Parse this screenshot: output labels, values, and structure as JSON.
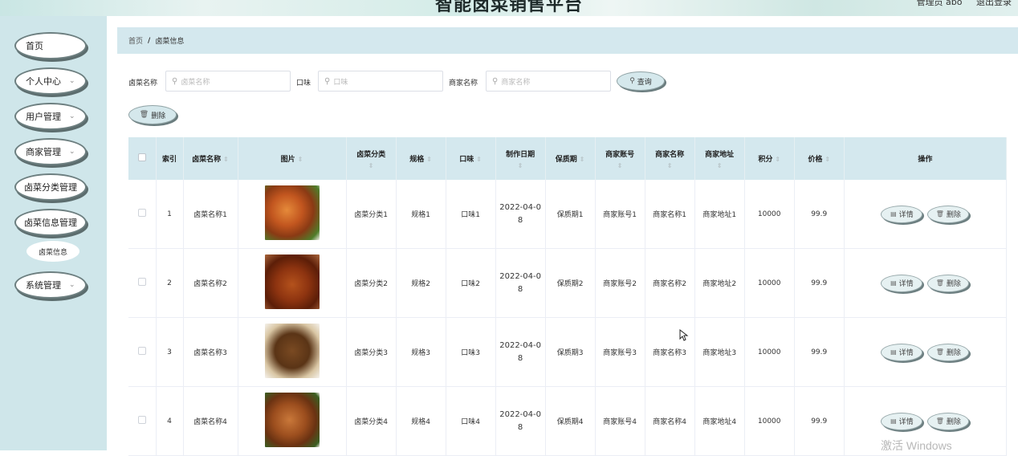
{
  "header": {
    "title": "智能卤菜销售平台",
    "user_label": "管理员 abo",
    "logout_label": "退出登录"
  },
  "sidebar": {
    "items": [
      {
        "label": "首页",
        "expandable": false
      },
      {
        "label": "个人中心",
        "expandable": true
      },
      {
        "label": "用户管理",
        "expandable": true
      },
      {
        "label": "商家管理",
        "expandable": true
      },
      {
        "label": "卤菜分类管理",
        "expandable": false
      },
      {
        "label": "卤菜信息管理",
        "expandable": false
      },
      {
        "label": "系统管理",
        "expandable": true
      }
    ],
    "submenu_label": "卤菜信息"
  },
  "breadcrumb": {
    "home": "首页",
    "separator": "/",
    "current": "卤菜信息"
  },
  "search": {
    "name_label": "卤菜名称",
    "name_placeholder": "卤菜名称",
    "flavor_label": "口味",
    "flavor_placeholder": "口味",
    "merchant_label": "商家名称",
    "merchant_placeholder": "商家名称",
    "query_button": "查询",
    "delete_button": "删除"
  },
  "table": {
    "headers": {
      "index": "索引",
      "name": "卤菜名称",
      "image": "图片",
      "category": "卤菜分类",
      "spec": "规格",
      "flavor": "口味",
      "made_date": "制作日期",
      "shelf_life": "保质期",
      "merchant_account": "商家账号",
      "merchant_name": "商家名称",
      "merchant_address": "商家地址",
      "points": "积分",
      "price": "价格",
      "actions": "操作"
    },
    "detail_button": "详情",
    "delete_button": "删除",
    "rows": [
      {
        "index": "1",
        "name": "卤菜名称1",
        "category": "卤菜分类1",
        "spec": "规格1",
        "flavor": "口味1",
        "date_a": "2022-04-0",
        "date_b": "8",
        "shelf_life": "保质期1",
        "merchant_account": "商家账号1",
        "merchant_name": "商家名称1",
        "merchant_address": "商家地址1",
        "points": "10000",
        "price": "99.9"
      },
      {
        "index": "2",
        "name": "卤菜名称2",
        "category": "卤菜分类2",
        "spec": "规格2",
        "flavor": "口味2",
        "date_a": "2022-04-0",
        "date_b": "8",
        "shelf_life": "保质期2",
        "merchant_account": "商家账号2",
        "merchant_name": "商家名称2",
        "merchant_address": "商家地址2",
        "points": "10000",
        "price": "99.9"
      },
      {
        "index": "3",
        "name": "卤菜名称3",
        "category": "卤菜分类3",
        "spec": "规格3",
        "flavor": "口味3",
        "date_a": "2022-04-0",
        "date_b": "8",
        "shelf_life": "保质期3",
        "merchant_account": "商家账号3",
        "merchant_name": "商家名称3",
        "merchant_address": "商家地址3",
        "points": "10000",
        "price": "99.9"
      },
      {
        "index": "4",
        "name": "卤菜名称4",
        "category": "卤菜分类4",
        "spec": "规格4",
        "flavor": "口味4",
        "date_a": "2022-04-0",
        "date_b": "8",
        "shelf_life": "保质期4",
        "merchant_account": "商家账号4",
        "merchant_name": "商家名称4",
        "merchant_address": "商家地址4",
        "points": "10000",
        "price": "99.9"
      }
    ]
  },
  "watermark": "激活 Windows",
  "colors": {
    "sidebar_bg": "#cfe6ea",
    "header_bg": "#d4e8ee",
    "button_bg": "#d5e8ec"
  }
}
